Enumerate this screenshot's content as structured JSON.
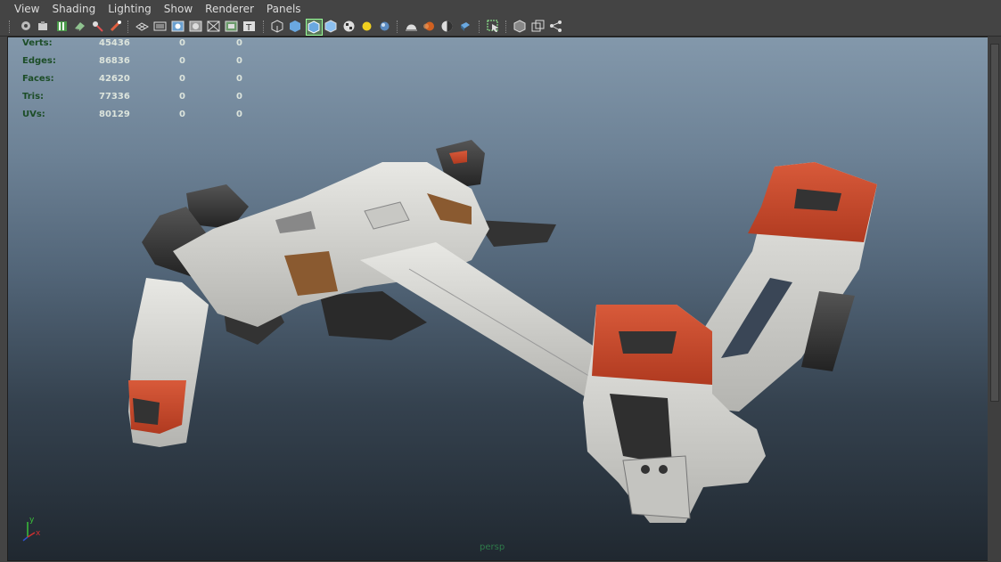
{
  "menu": {
    "items": [
      "View",
      "Shading",
      "Lighting",
      "Show",
      "Renderer",
      "Panels"
    ]
  },
  "toolbar": {
    "icons": [
      "camera-select-icon",
      "camera-attributes-icon",
      "bookmark-icon",
      "image-plane-icon",
      "grease-pencil-icon",
      "camera-lock-icon",
      "grid-icon",
      "film-gate-icon",
      "resolution-gate-icon",
      "gate-mask-icon",
      "field-chart-icon",
      "safe-title-icon",
      "wireframe-icon",
      "smooth-shade-icon",
      "wireframe-on-shaded-icon",
      "default-material-icon",
      "textured-icon",
      "use-lights-icon",
      "shadows-icon",
      "screen-space-ao-icon",
      "motion-blur-icon",
      "anti-aliasing-icon",
      "depth-of-field-icon",
      "isolate-select-icon",
      "xray-icon",
      "xray-active-components-icon",
      "xray-joints-icon"
    ]
  },
  "hud": {
    "stats": [
      {
        "label": "Verts:",
        "v1": "45436",
        "v2": "0",
        "v3": "0"
      },
      {
        "label": "Edges:",
        "v1": "86836",
        "v2": "0",
        "v3": "0"
      },
      {
        "label": "Faces:",
        "v1": "42620",
        "v2": "0",
        "v3": "0"
      },
      {
        "label": "Tris:",
        "v1": "77336",
        "v2": "0",
        "v3": "0"
      },
      {
        "label": "UVs:",
        "v1": "80129",
        "v2": "0",
        "v3": "0"
      }
    ],
    "camera": "persp",
    "axis": {
      "y": "y",
      "x": "x"
    }
  },
  "colors": {
    "hull": "#d6d6d2",
    "accent": "#c8462a",
    "dark": "#3a3a3a",
    "hud_label": "#1c4d27"
  }
}
